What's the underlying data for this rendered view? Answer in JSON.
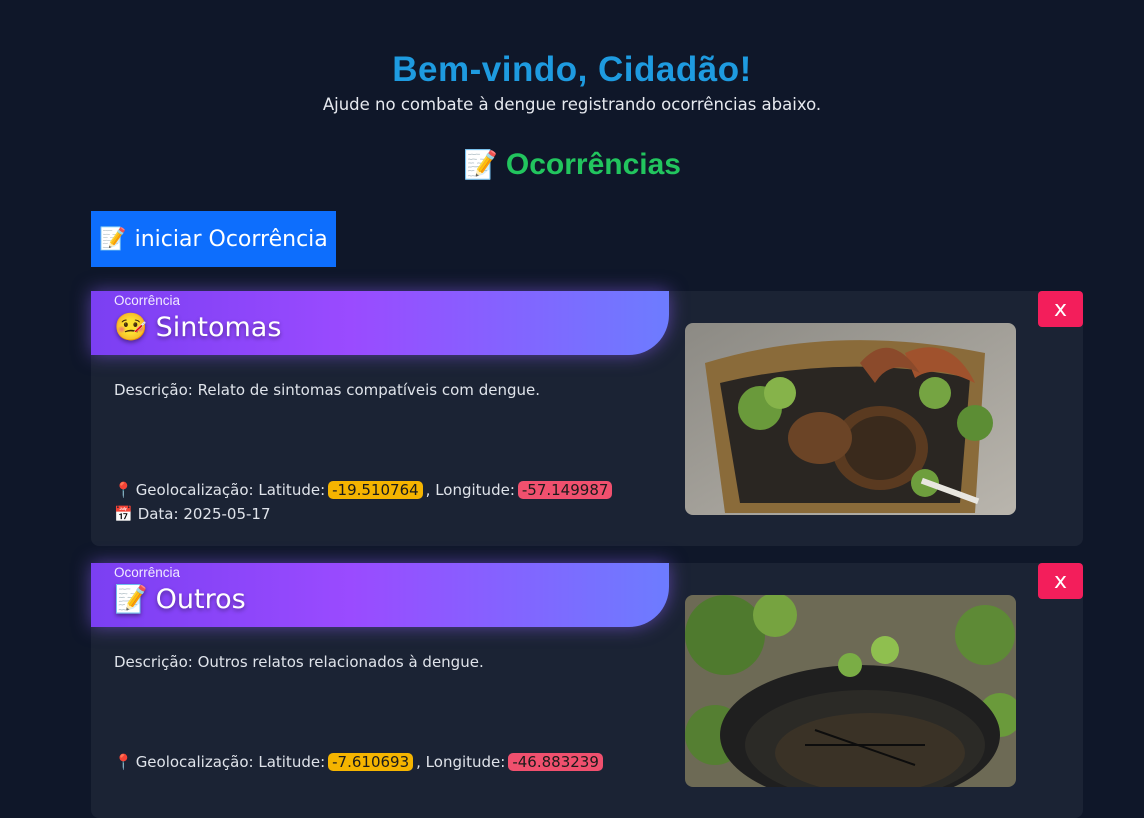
{
  "header": {
    "title": "Bem-vindo, Cidadão!",
    "subtitle": "Ajude no combate à dengue registrando ocorrências abaixo."
  },
  "section": {
    "icon": "memo-icon",
    "title": "Ocorrências"
  },
  "start_button": {
    "icon": "memo-icon",
    "label": "iniciar Ocorrência"
  },
  "occurrences": [
    {
      "kind_label": "Ocorrência",
      "icon": "sick-face-icon",
      "title": "Sintomas",
      "description": "Descrição: Relato de sintomas compatíveis com dengue.",
      "geo_prefix": "Geolocalização: Latitude:",
      "latitude": "-19.510764",
      "lon_prefix": ", Longitude:",
      "longitude": "-57.149987",
      "date": "Data: 2025-05-17",
      "close_label": "x",
      "photo": "container-with-stagnant-water-and-leaves"
    },
    {
      "kind_label": "Ocorrência",
      "icon": "memo-icon",
      "title": "Outros",
      "description": "Descrição: Outros relatos relacionados à dengue.",
      "geo_prefix": "Geolocalização: Latitude:",
      "latitude": "-7.610693",
      "lon_prefix": ", Longitude:",
      "longitude": "-46.883239",
      "date": "",
      "close_label": "x",
      "photo": "plant-pot-saucer-with-stagnant-water"
    }
  ],
  "colors": {
    "background": "#0f1729",
    "title": "#1e9be0",
    "section_title": "#22c55e",
    "button": "#0d6efd",
    "close": "#f31e5b",
    "latitude_badge": "#f5b400",
    "longitude_badge": "#f0506e"
  }
}
